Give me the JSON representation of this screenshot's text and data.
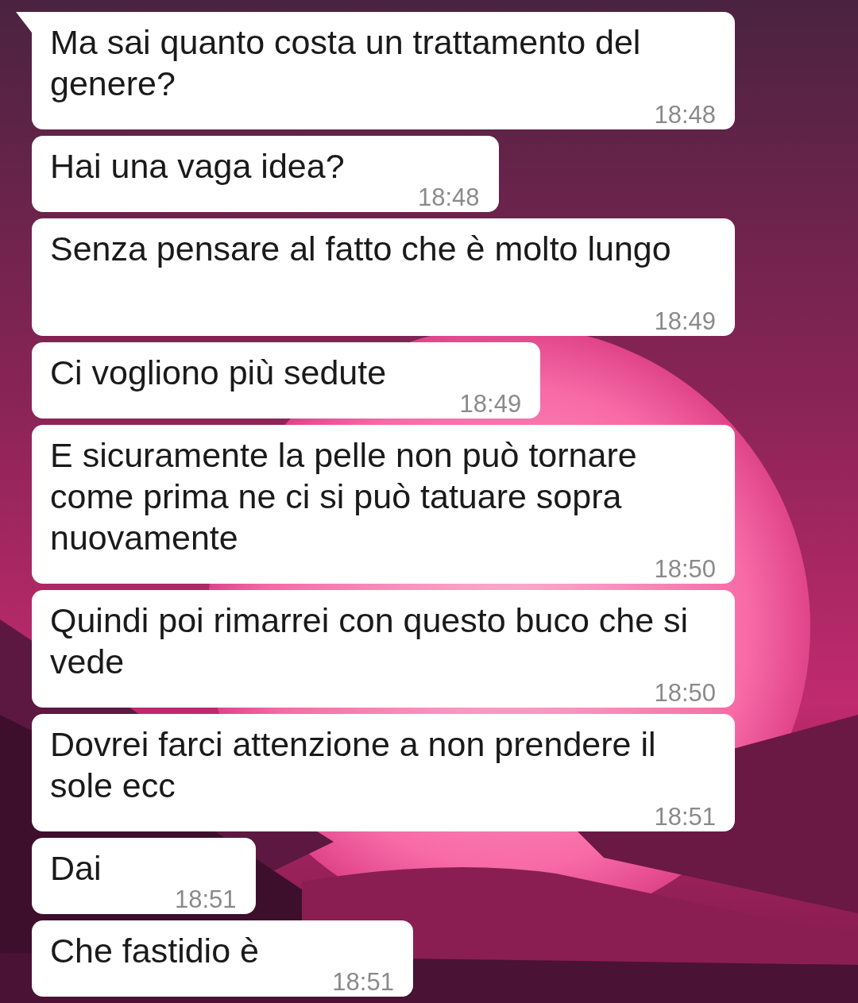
{
  "messages": [
    {
      "text": "Ma sai quanto costa un trattamento del genere?",
      "time": "18:48",
      "tail": true
    },
    {
      "text": "Hai una vaga idea?",
      "time": "18:48",
      "tail": false
    },
    {
      "text": "Senza pensare al fatto che è molto lungo",
      "time": "18:49",
      "tail": false
    },
    {
      "text": "Ci vogliono più sedute",
      "time": "18:49",
      "tail": false
    },
    {
      "text": "E sicuramente la pelle non può tornare come prima ne ci si può tatuare sopra nuovamente",
      "time": "18:50",
      "tail": false
    },
    {
      "text": "Quindi poi rimarrei con questo buco che si vede",
      "time": "18:50",
      "tail": false
    },
    {
      "text": "Dovrei farci attenzione a non prendere il sole ecc",
      "time": "18:51",
      "tail": false
    },
    {
      "text": "Dai",
      "time": "18:51",
      "tail": false
    },
    {
      "text": "Che fastidio è",
      "time": "18:51",
      "tail": false
    }
  ]
}
